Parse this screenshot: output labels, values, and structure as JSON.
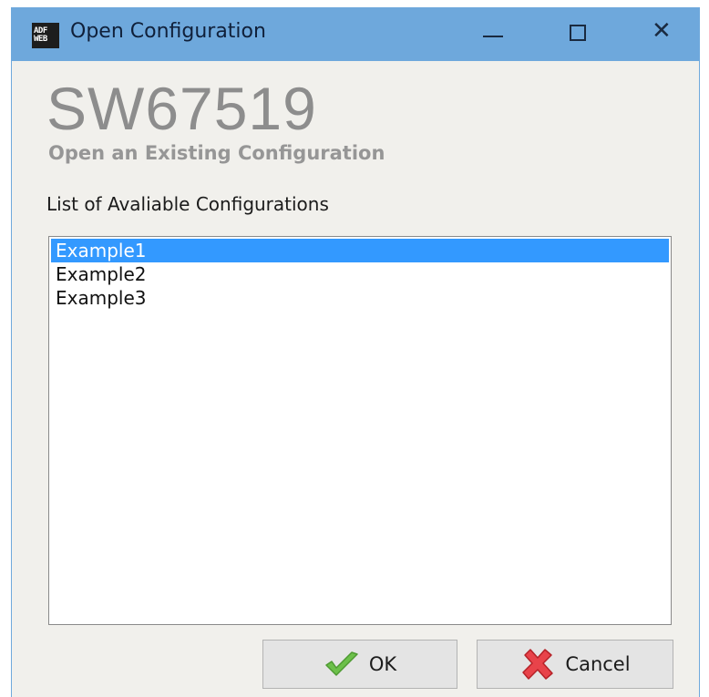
{
  "window": {
    "title": "Open Configuration",
    "icon_text": {
      "line1": "ADF",
      "line2": "WEB"
    }
  },
  "header": {
    "product": "SW67519",
    "subtitle": "Open an Existing Configuration"
  },
  "list": {
    "label": "List of Avaliable Configurations",
    "items": [
      "Example1",
      "Example2",
      "Example3"
    ],
    "selected_index": 0
  },
  "buttons": {
    "ok_label": "OK",
    "cancel_label": "Cancel"
  },
  "icons": {
    "ok": "green-check-icon",
    "cancel": "red-x-icon"
  },
  "colors": {
    "titlebar": "#6ea8dc",
    "selection": "#3399ff",
    "check_green": "#6cc04a",
    "cancel_red": "#e8434a"
  }
}
